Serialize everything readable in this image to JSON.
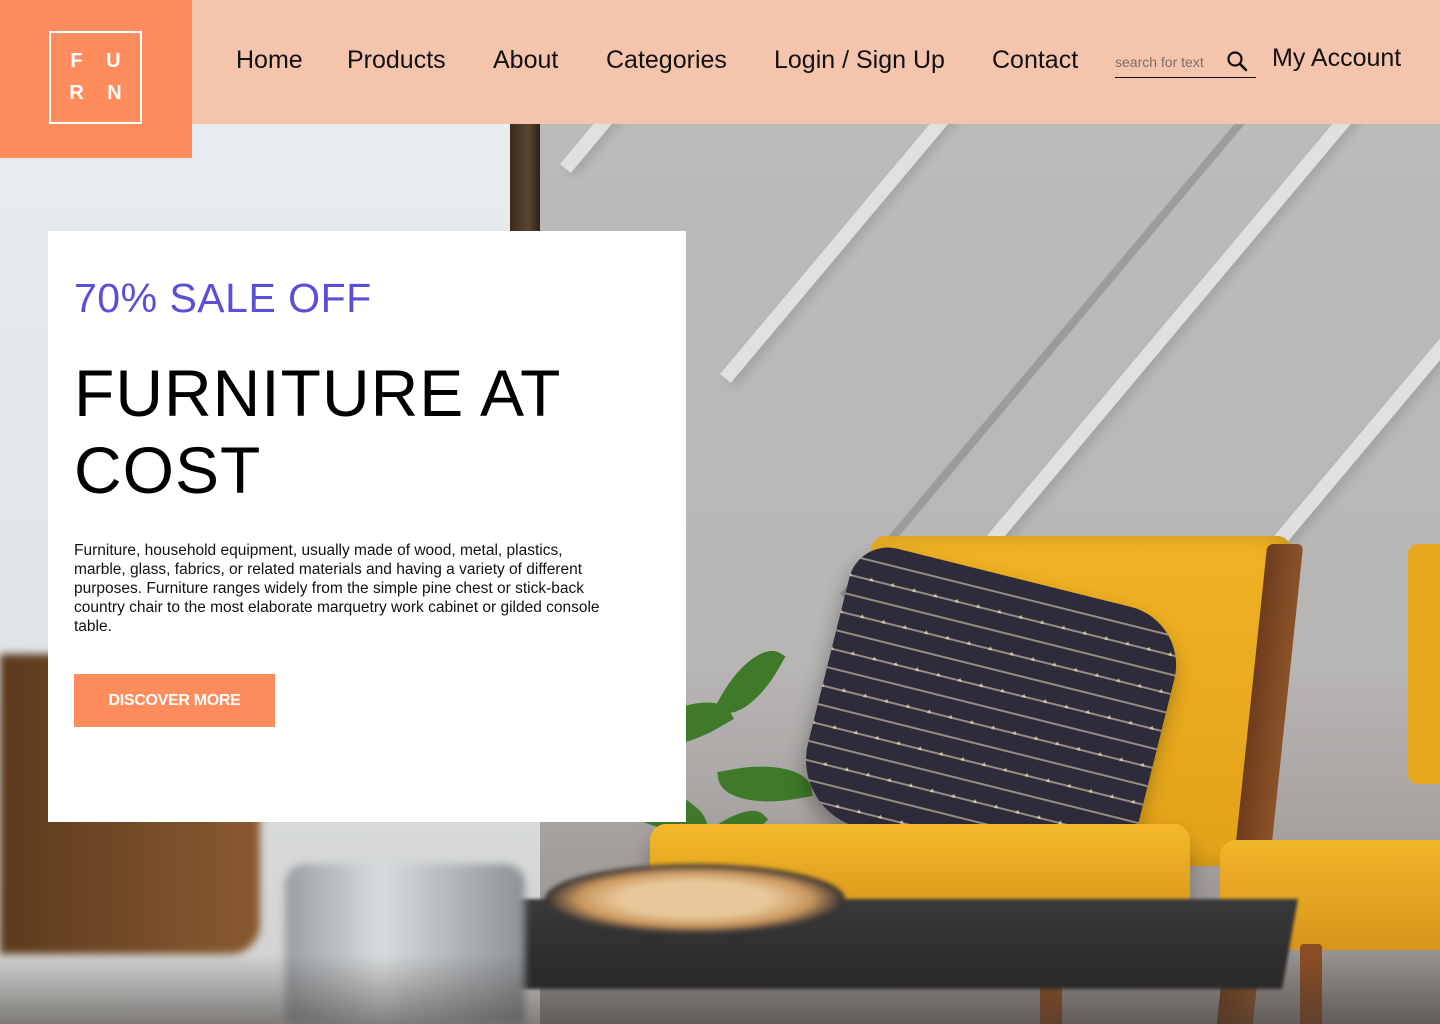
{
  "brand": {
    "logo_line1": "F U",
    "logo_line2": "R N",
    "accent_color": "#ff8c5c",
    "header_color": "#f5c4ad"
  },
  "nav": {
    "items": [
      {
        "label": "Home"
      },
      {
        "label": "Products"
      },
      {
        "label": "About"
      },
      {
        "label": "Categories"
      },
      {
        "label": "Login / Sign Up"
      },
      {
        "label": "Contact"
      }
    ]
  },
  "search": {
    "placeholder": "search for text",
    "value": "",
    "icon": "search-icon"
  },
  "account": {
    "label": "My Account"
  },
  "promo": {
    "sale_text": "70% SALE OFF",
    "sale_color": "#5b4fd8",
    "headline": "FURNITURE AT COST",
    "description": "Furniture, household equipment, usually made of wood, metal, plastics, marble, glass, fabrics, or related materials and having a variety of different purposes. Furniture ranges widely from the simple pine chest or stick-back country chair to the most elaborate marquetry work cabinet or gilded console table.",
    "cta_label": "DISCOVER MORE"
  }
}
